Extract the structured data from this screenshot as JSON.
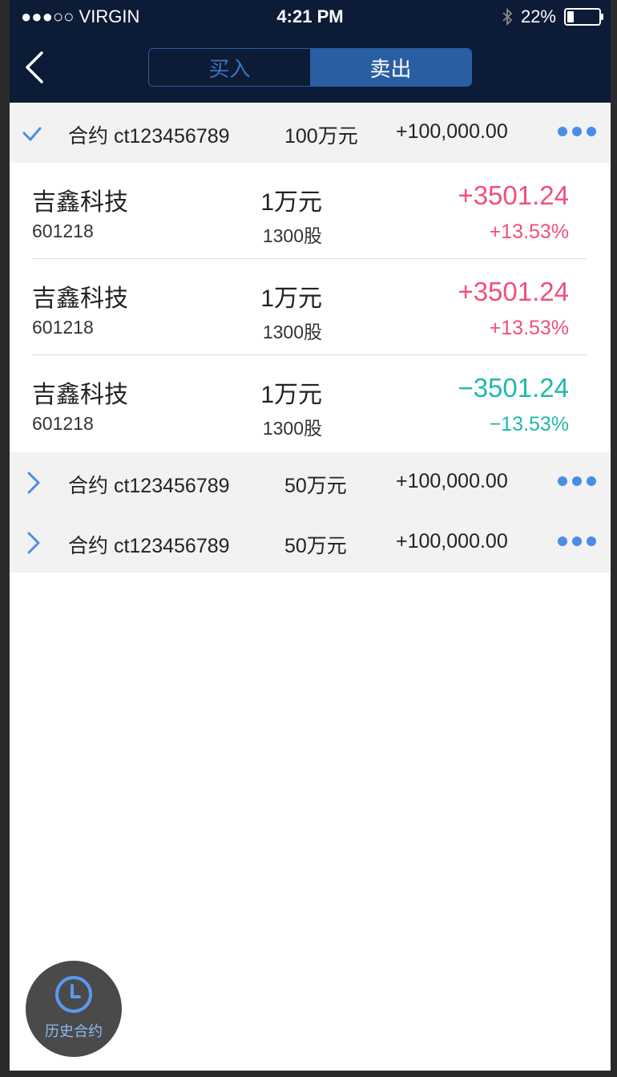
{
  "status_bar": {
    "carrier": "●●●○○ VIRGIN",
    "time": "4:21 PM",
    "battery": "22%"
  },
  "nav": {
    "tabs": [
      {
        "label": "买入",
        "selected": false
      },
      {
        "label": "卖出",
        "selected": true
      }
    ]
  },
  "colors": {
    "positive": "#f0507a",
    "negative": "#1fb8ad",
    "accent": "#4a8de6",
    "header_bg": "#0c1b36"
  },
  "contracts": [
    {
      "name": "合约 ct123456789",
      "amount": "100万元",
      "profit": "+100,000.00",
      "expanded": true,
      "stocks": [
        {
          "name": "吉鑫科技",
          "code": "601218",
          "amount": "1万元",
          "shares": "1300股",
          "value": "+3501.24",
          "percent": "+13.53%",
          "direction": "up"
        },
        {
          "name": "吉鑫科技",
          "code": "601218",
          "amount": "1万元",
          "shares": "1300股",
          "value": "+3501.24",
          "percent": "+13.53%",
          "direction": "up"
        },
        {
          "name": "吉鑫科技",
          "code": "601218",
          "amount": "1万元",
          "shares": "1300股",
          "value": "−3501.24",
          "percent": "−13.53%",
          "direction": "down"
        }
      ]
    },
    {
      "name": "合约 ct123456789",
      "amount": "50万元",
      "profit": "+100,000.00",
      "expanded": false
    },
    {
      "name": "合约 ct123456789",
      "amount": "50万元",
      "profit": "+100,000.00",
      "expanded": false
    }
  ],
  "history_button": {
    "label": "历史合约"
  }
}
